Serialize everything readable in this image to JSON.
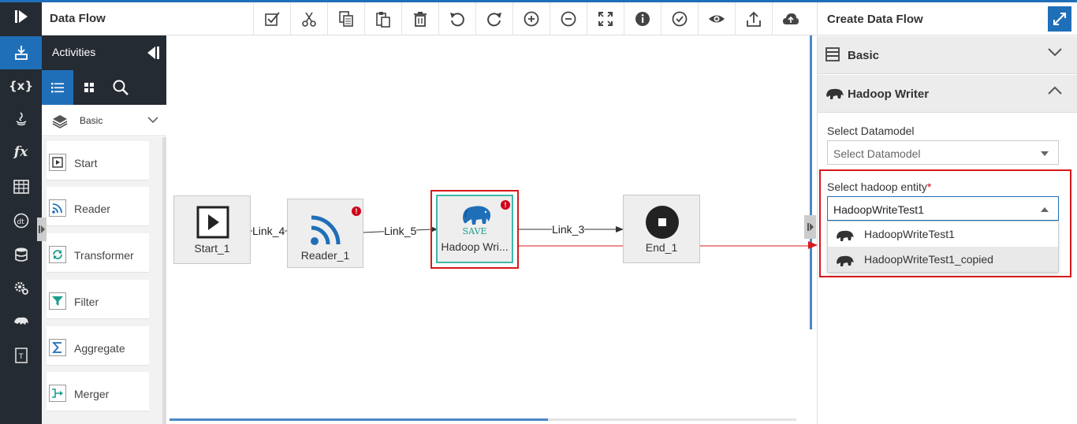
{
  "app": {
    "title": "Data Flow"
  },
  "toolbar": {
    "tools": [
      "validate-checkbox",
      "cut",
      "copy",
      "paste",
      "delete",
      "undo",
      "redo",
      "zoom-in",
      "zoom-out",
      "fit-screen",
      "info",
      "check",
      "preview",
      "export",
      "cloud-deploy"
    ]
  },
  "activities": {
    "title": "Activities",
    "category": "Basic",
    "items": [
      {
        "label": "Start",
        "icon": "play-icon"
      },
      {
        "label": "Reader",
        "icon": "rss-icon"
      },
      {
        "label": "Transformer",
        "icon": "transform-icon"
      },
      {
        "label": "Filter",
        "icon": "filter-icon"
      },
      {
        "label": "Aggregate",
        "icon": "sigma-icon"
      },
      {
        "label": "Merger",
        "icon": "merge-icon"
      }
    ]
  },
  "canvas": {
    "nodes": {
      "start": "Start_1",
      "reader": "Reader_1",
      "writer": "Hadoop Wri...",
      "writer_badge": "SAVE",
      "end": "End_1"
    },
    "links": {
      "link4": "Link_4",
      "link5": "Link_5",
      "link3": "Link_3"
    }
  },
  "panel": {
    "title": "Create Data Flow",
    "sections": {
      "basic": "Basic",
      "hadoop": "Hadoop Writer"
    },
    "datamodel": {
      "label": "Select Datamodel",
      "placeholder": "Select Datamodel"
    },
    "entity": {
      "label": "Select hadoop entity",
      "required": "*",
      "value": "HadoopWriteTest1",
      "options": [
        "HadoopWriteTest1",
        "HadoopWriteTest1_copied"
      ]
    }
  },
  "colors": {
    "accent": "#1f6fb8",
    "dark": "#252b33",
    "highlight": "#d7191c",
    "writer_border": "#3fb8a8"
  }
}
